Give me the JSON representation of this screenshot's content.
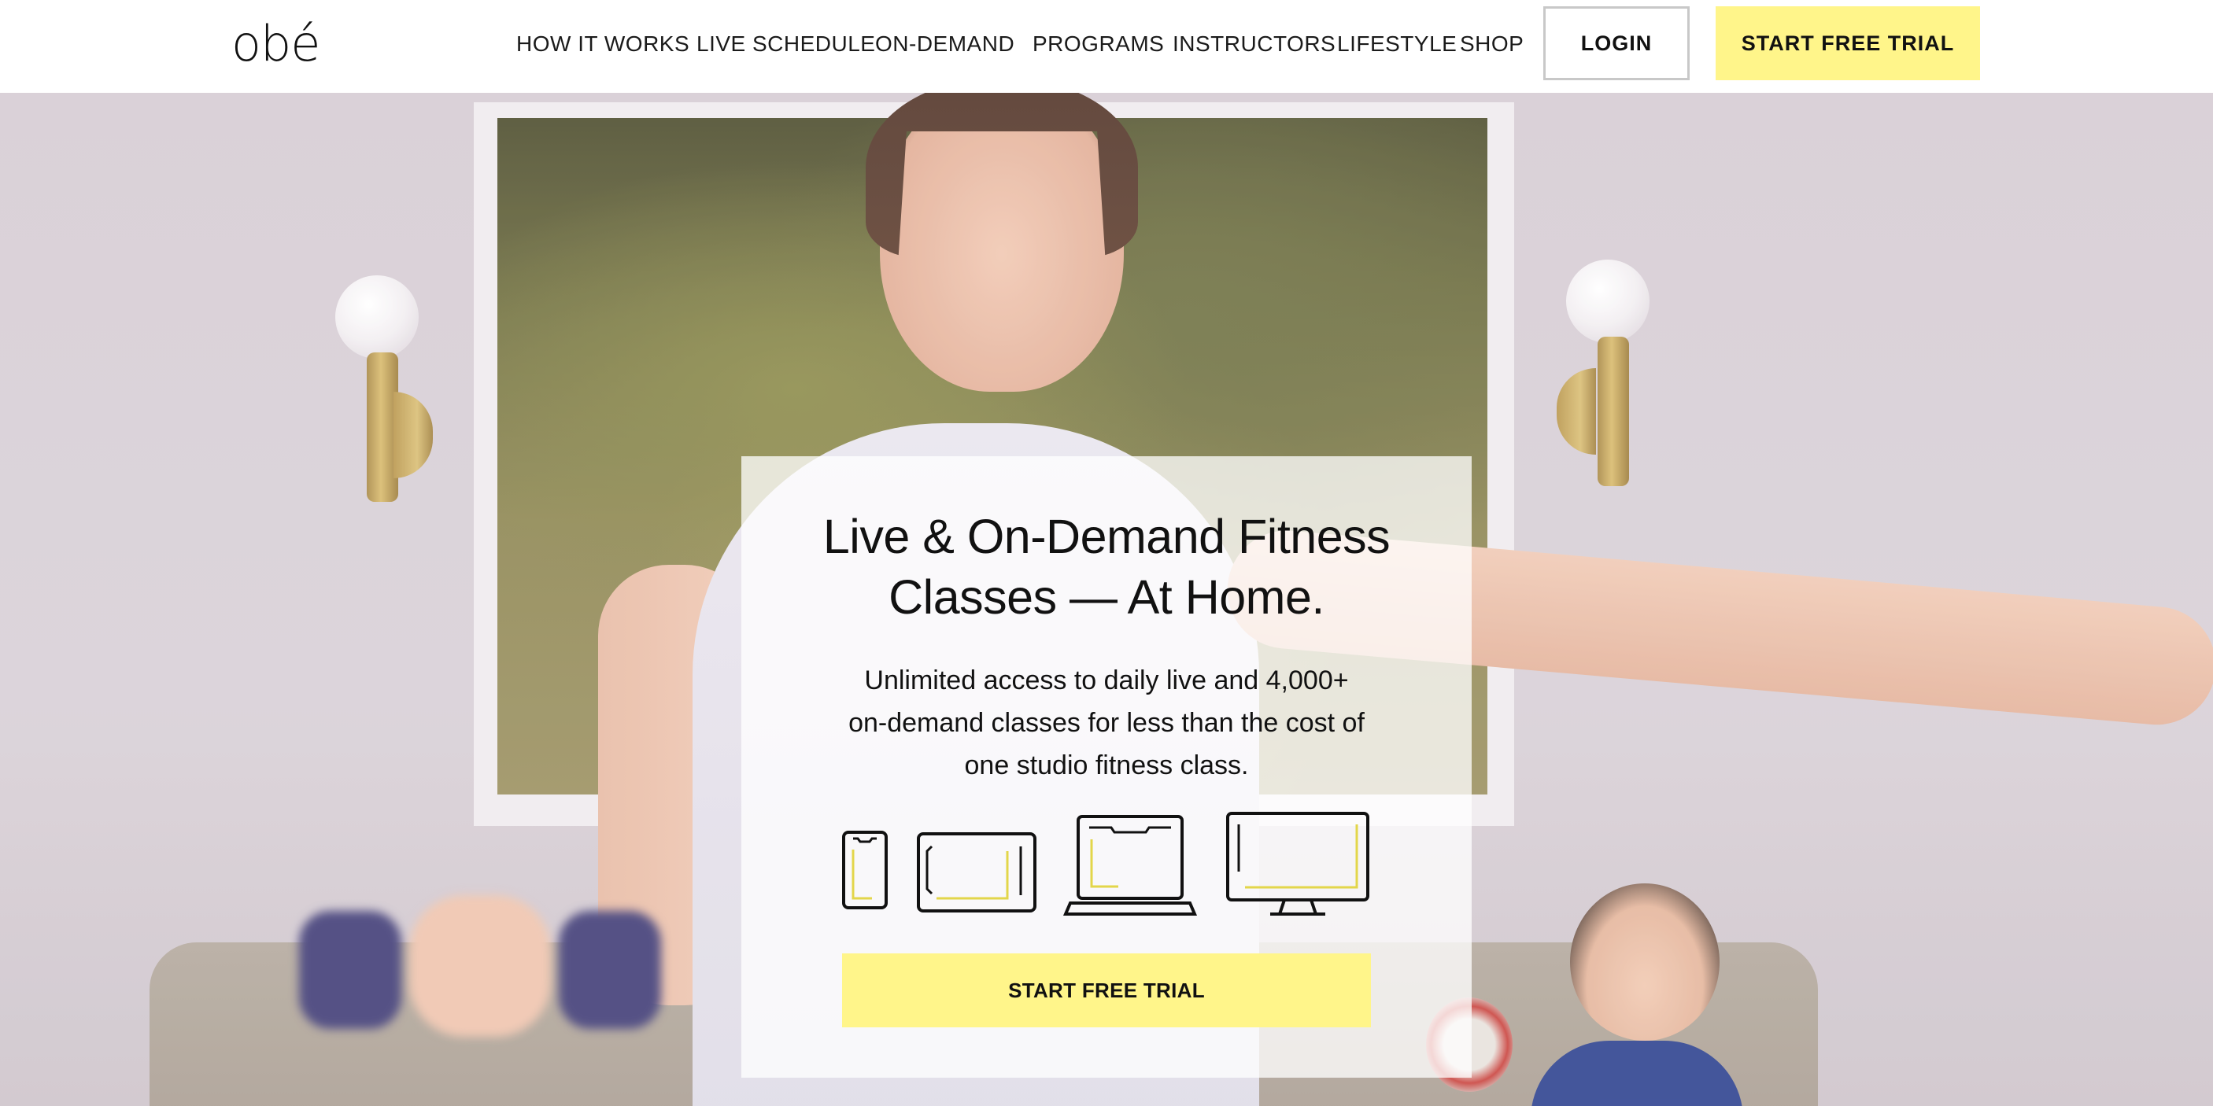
{
  "header": {
    "logo": "obé",
    "nav": [
      {
        "label": "HOW IT WORKS"
      },
      {
        "label": "LIVE SCHEDULE"
      },
      {
        "label": "ON-DEMAND"
      },
      {
        "label": "PROGRAMS"
      },
      {
        "label": "INSTRUCTORS"
      },
      {
        "label": "LIFESTYLE"
      },
      {
        "label": "SHOP"
      }
    ],
    "login_label": "LOGIN",
    "trial_label": "START FREE TRIAL"
  },
  "hero": {
    "headline_lines": [
      "Live & On-Demand Fitness",
      "Classes — At Home."
    ],
    "subtext_lines": [
      "Unlimited access to daily live and 4,000+",
      "on-demand classes for less than the cost of",
      "one studio fitness class."
    ],
    "devices": [
      "phone-icon",
      "tablet-icon",
      "laptop-icon",
      "desktop-icon"
    ],
    "cta_label": "START FREE TRIAL"
  },
  "colors": {
    "accent_yellow": "#fff58a",
    "text": "#111111",
    "login_border": "#c8c8c8"
  }
}
